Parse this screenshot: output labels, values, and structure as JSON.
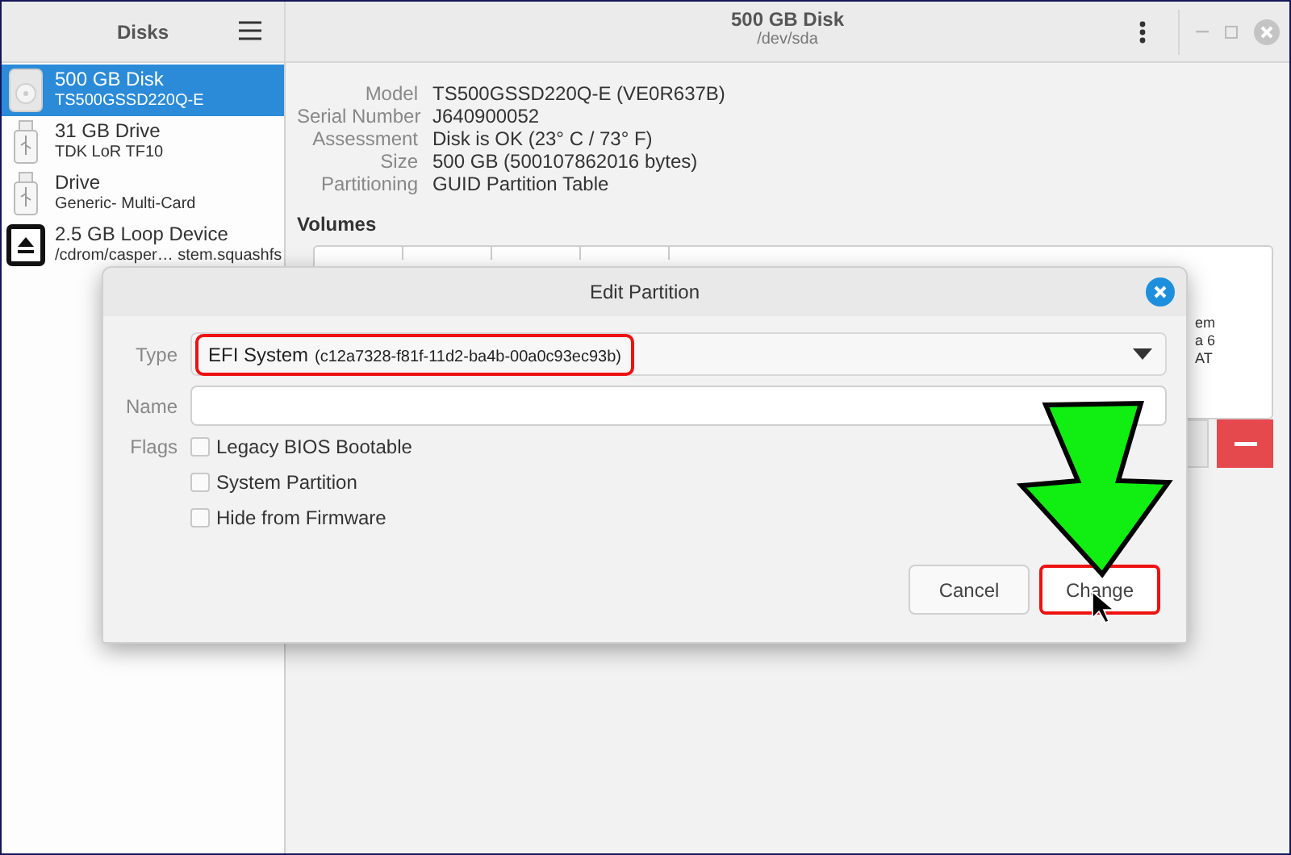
{
  "window": {
    "title": "500 GB Disk",
    "subtitle": "/dev/sda"
  },
  "sidebar": {
    "title": "Disks",
    "items": [
      {
        "kind": "disk",
        "name": "500 GB Disk",
        "detail": "TS500GSSD220Q-E",
        "selected": true
      },
      {
        "kind": "usb",
        "name": "31 GB Drive",
        "detail": "TDK LoR TF10",
        "selected": false
      },
      {
        "kind": "usb",
        "name": "Drive",
        "detail": "Generic- Multi-Card",
        "selected": false
      },
      {
        "kind": "loop",
        "name": "2.5 GB Loop Device",
        "detail": "/cdrom/casper… stem.squashfs",
        "selected": false
      }
    ]
  },
  "details": [
    {
      "label": "Model",
      "value": "TS500GSSD220Q-E (VE0R637B)"
    },
    {
      "label": "Serial Number",
      "value": "J640900052"
    },
    {
      "label": "Assessment",
      "value": "Disk is OK (23° C / 73° F)"
    },
    {
      "label": "Size",
      "value": "500 GB (500107862016 bytes)"
    },
    {
      "label": "Partitioning",
      "value": "GUID Partition Table"
    }
  ],
  "volumes": {
    "heading": "Volumes",
    "fragments": [
      "em",
      "a 6",
      "AT"
    ]
  },
  "dialog": {
    "title": "Edit Partition",
    "type_label": "Type",
    "type_name": "EFI System",
    "type_guid": "(c12a7328-f81f-11d2-ba4b-00a0c93ec93b)",
    "type_highlighted": true,
    "name_label": "Name",
    "flags_label": "Flags",
    "flags": [
      {
        "label": "Legacy BIOS Bootable",
        "checked": false
      },
      {
        "label": "System Partition",
        "checked": false
      },
      {
        "label": "Hide from Firmware",
        "checked": false
      }
    ],
    "buttons": [
      {
        "label": "Cancel",
        "highlighted": false
      },
      {
        "label": "Change",
        "highlighted": true
      }
    ]
  }
}
